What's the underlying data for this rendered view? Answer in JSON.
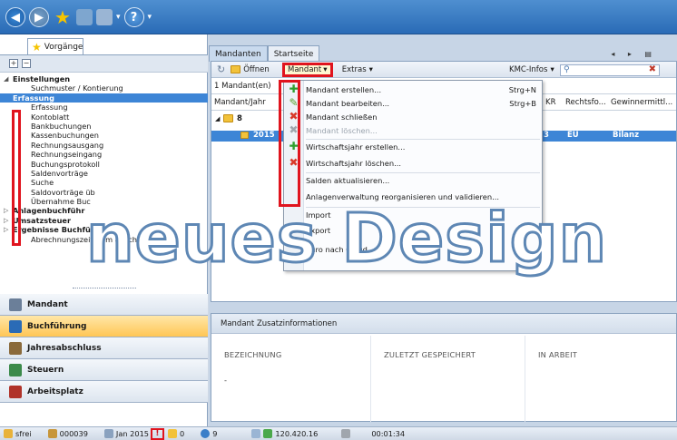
{
  "quick_access": {
    "icons": [
      "back-arrow-icon",
      "forward-arrow-icon",
      "star-icon",
      "save-disk-icon",
      "print-icon",
      "help-icon"
    ]
  },
  "left": {
    "tab_label": "Vorgänge",
    "tree": [
      {
        "label": "Einstellungen",
        "level": 0,
        "expanded": true
      },
      {
        "label": "Suchmuster / Kontierung",
        "level": 1
      },
      {
        "label": "Erfassung",
        "level": 0,
        "selected": true
      },
      {
        "label": "Erfassung",
        "level": 1
      },
      {
        "label": "Kontoblatt",
        "level": 1
      },
      {
        "label": "Bankbuchungen",
        "level": 1
      },
      {
        "label": "Kassenbuchungen",
        "level": 1
      },
      {
        "label": "Rechnungsausgang",
        "level": 1
      },
      {
        "label": "Rechnungseingang",
        "level": 1
      },
      {
        "label": "Buchungsprotokoll",
        "level": 1
      },
      {
        "label": "Saldenvorträge",
        "level": 1
      },
      {
        "label": "Suche",
        "level": 1
      },
      {
        "label": "Saldovorträge üb",
        "level": 1
      },
      {
        "label": "Übernahme Buc",
        "level": 1
      },
      {
        "label": "Anlagenbuchführ",
        "level": 0
      },
      {
        "label": "Umsatzsteuer",
        "level": 0
      },
      {
        "label": "Ergebnisse Buchführung",
        "level": 0
      },
      {
        "label": "Abrechnungszeitraum abschließen",
        "level": 1
      }
    ],
    "nav": [
      {
        "label": "Mandant",
        "active": false,
        "color": "#6b7f99"
      },
      {
        "label": "Buchführung",
        "active": true,
        "color": "#2a6bb6"
      },
      {
        "label": "Jahresabschluss",
        "active": false,
        "color": "#8a6a3b"
      },
      {
        "label": "Steuern",
        "active": false,
        "color": "#3b8a4a"
      },
      {
        "label": "Arbeitsplatz",
        "active": false,
        "color": "#b0332a"
      }
    ]
  },
  "tabs": [
    {
      "label": "Mandanten",
      "active": true
    },
    {
      "label": "Startseite",
      "active": false
    }
  ],
  "toolbar": {
    "open": "Öffnen",
    "mandant": "Mandant",
    "extras": "Extras",
    "kmc": "KMC-Infos"
  },
  "grid": {
    "count": "1 Mandant(en)",
    "col_year": "Mandant/Jahr",
    "col_skr": "KR",
    "col_form": "Rechtsfo...",
    "col_profit": "Gewinnermittl...",
    "group": "8",
    "row": {
      "year": "2015",
      "skr": "3",
      "form": "EU",
      "profit": "Bilanz"
    }
  },
  "menu": [
    {
      "label": "Mandant erstellen...",
      "shortcut": "Strg+N",
      "icon": "plus-icon",
      "color": "#2e9e2e"
    },
    {
      "label": "Mandant bearbeiten...",
      "shortcut": "Strg+B",
      "icon": "pencil-icon",
      "color": "#5aa02c"
    },
    {
      "label": "Mandant schließen",
      "shortcut": "",
      "icon": "close-icon",
      "color": "#d93a2a"
    },
    {
      "label": "Mandant löschen...",
      "shortcut": "",
      "icon": "delete-icon",
      "color": "#a0a6ad",
      "disabled": true
    },
    {
      "label": "Wirtschaftsjahr erstellen...",
      "shortcut": "",
      "icon": "plus-icon",
      "color": "#2e9e2e"
    },
    {
      "label": "Wirtschaftsjahr löschen...",
      "shortcut": "",
      "icon": "delete-icon",
      "color": "#d93a2a"
    },
    {
      "label": "Salden aktualisieren...",
      "shortcut": "",
      "icon": "",
      "color": ""
    },
    {
      "label": "Anlagenverwaltung reorganisieren und validieren...",
      "shortcut": "",
      "icon": "",
      "color": ""
    },
    {
      "label": "Import",
      "shortcut": "",
      "icon": "",
      "color": ""
    },
    {
      "label": "Export",
      "shortcut": "",
      "icon": "",
      "color": ""
    },
    {
      "label": "Euro nach Cloud",
      "shortcut": "",
      "icon": "",
      "color": ""
    }
  ],
  "info": {
    "title": "Mandant Zusatzinformationen",
    "c1": "BEZEICHNUNG",
    "c2": "ZULETZT GESPEICHERT",
    "c3": "IN ARBEIT",
    "c1_value": "-"
  },
  "status": {
    "user": "sfrei",
    "client": "000039",
    "period": "Jan 2015",
    "n1": "0",
    "n2": "9",
    "ip": "120.420.16",
    "time": "00:01:34"
  },
  "watermark": "neues Design"
}
